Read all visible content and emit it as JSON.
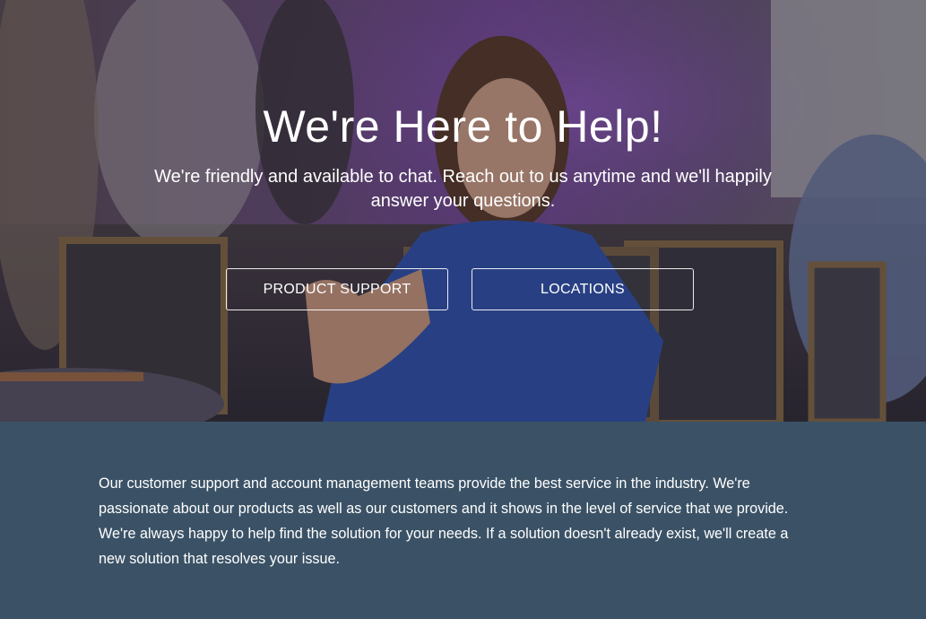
{
  "hero": {
    "title": "We're Here to Help!",
    "subtitle": "We're friendly and available to chat. Reach out to us anytime and we'll happily answer your questions.",
    "buttons": {
      "product_support": "PRODUCT SUPPORT",
      "locations": "LOCATIONS"
    }
  },
  "info": {
    "paragraph": "Our customer support and account management teams provide the best service in the industry. We're passionate about our products as well as our customers and it shows in the level of service that we provide. We're always happy to help find the solution for your needs. If a solution doesn't already exist, we'll create a new solution that resolves your issue."
  },
  "colors": {
    "info_background": "#3b5266",
    "text": "#ffffff"
  }
}
